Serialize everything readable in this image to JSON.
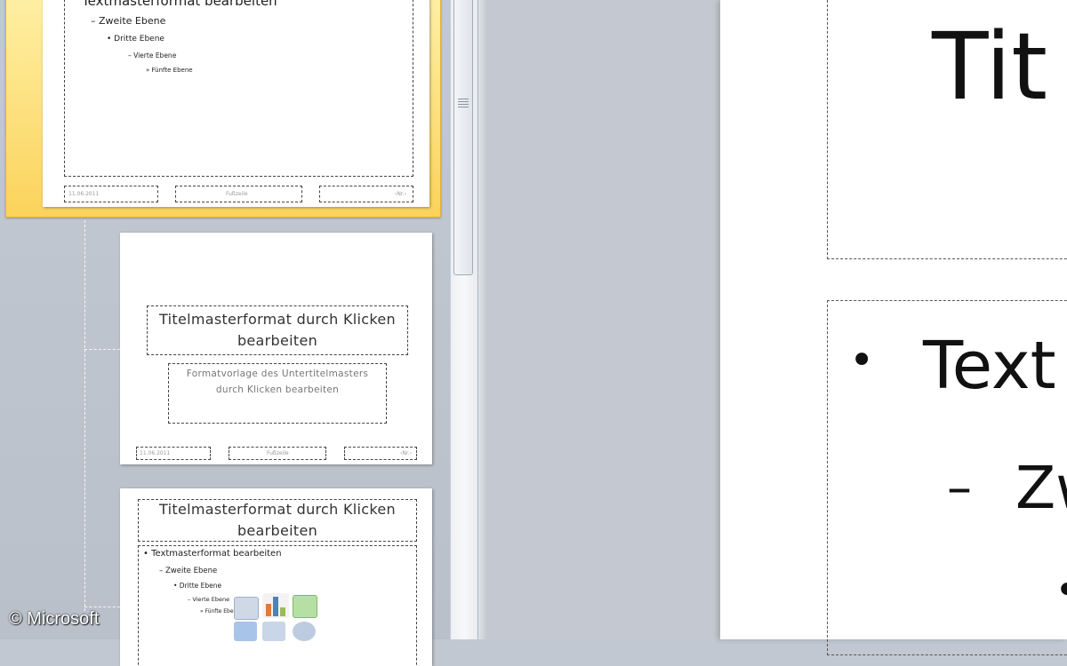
{
  "thumbnails": {
    "master": {
      "body_levels": [
        "Textmasterformat bearbeiten",
        "– Zweite Ebene",
        "• Dritte Ebene",
        "– Vierte Ebene",
        "» Fünfte Ebene"
      ],
      "footer_date": "11.06.2011",
      "footer_center": "Fußzeile",
      "footer_num": "‹Nr.›"
    },
    "title_layout": {
      "title": "Titelmasterformat durch Klicken bearbeiten",
      "subtitle": "Formatvorlage des Untertitelmasters durch Klicken bearbeiten",
      "footer_date": "11.06.2011",
      "footer_center": "Fußzeile",
      "footer_num": "‹Nr.›"
    },
    "content_layout": {
      "title": "Titelmasterformat durch Klicken bearbeiten",
      "body_levels": [
        "• Textmasterformat bearbeiten",
        "– Zweite Ebene",
        "• Dritte Ebene",
        "– Vierte Ebene",
        "» Fünfte Ebene"
      ]
    }
  },
  "main_slide": {
    "title_fragment": "Tit",
    "bullet_1": "Text",
    "bullet_1_marker": "•",
    "bullet_2": "Zw",
    "bullet_2_marker": "–",
    "bullet_3_marker": "•"
  },
  "watermark": "© Microsoft",
  "colors": {
    "selection": "#fbd35c",
    "pane": "#c2c8d1"
  }
}
